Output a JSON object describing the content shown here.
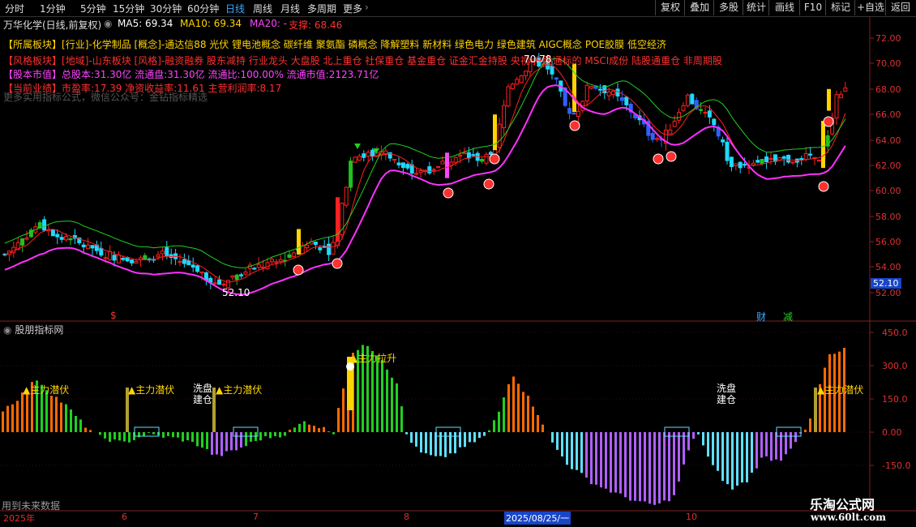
{
  "toolbar": {
    "timeframes": [
      "分时",
      "1分钟",
      "5分钟",
      "15分钟",
      "30分钟",
      "60分钟",
      "日线",
      "周线",
      "月线",
      "多周期",
      "更多"
    ],
    "active_timeframe": "日线",
    "right_buttons": [
      "复权",
      "叠加",
      "多股",
      "统计",
      "画线",
      "F10",
      "标记",
      "+自选",
      "返回"
    ]
  },
  "chart_header": {
    "title": "万华化学(日线,前复权)",
    "ma5": "MA5: 69.34",
    "ma10": "MA10: 69.34",
    "ma20": "MA20: -",
    "support": "支撑: 68.46"
  },
  "info_lines": [
    {
      "label": "【所属板块】",
      "value": "[行业]-化学制品 [概念]-通达信88 光伏 锂电池概念 碳纤维 聚氨酯 磷概念 降解塑料 新材料 绿色电力 绿色建筑 AIGC概念 POE胶膜 低空经济"
    },
    {
      "label": "【风格板块】",
      "value": "[地域]-山东板块 [风格]-融资融券 股东减持 行业龙头 大盘股 北上重仓 社保重仓 基金重仓 证金汇金持股 央视 户股通标的 MSCI成份 陆股通重仓 非周期股"
    },
    {
      "label": "【股本市值】",
      "value": "总股本:31.30亿 流通盘:31.30亿 流通比:100.00% 流通市值:2123.71亿"
    },
    {
      "label": "【当前业绩】",
      "value": "市盈率:17.39 净资收益率:11.61 主营利润率:8.17"
    }
  ],
  "watermark_text": "更多实用指标公式，微信公众号：金钻指标精选",
  "price_axis": [
    "72.00",
    "70.00",
    "68.00",
    "66.00",
    "64.00",
    "62.00",
    "60.00",
    "58.00",
    "56.00",
    "54.00",
    "52.00"
  ],
  "current_price_tag": "52.10",
  "high_label": "70.78",
  "low_label": "52.10",
  "markers": {
    "cai": "财",
    "jian": "减",
    "dollar": "$"
  },
  "indicator": {
    "name": "股朋指标网",
    "axis": [
      "450.0",
      "300.0",
      "150.0",
      "0.00",
      "-150.0"
    ],
    "labels": [
      "主力潜伏",
      "主力潜伏",
      "主力潜伏",
      "主力拉升",
      "主力潜伏"
    ],
    "wash_label": "洗盘\n建仓",
    "footer_note": "用到未来数据"
  },
  "x_axis": [
    "2025年",
    "6",
    "7",
    "8",
    "2025/08/25/一",
    "10"
  ],
  "brand": {
    "name": "乐淘公式网",
    "url": "www.60lt.com"
  },
  "chart_data": {
    "type": "candlestick",
    "title": "万华化学(日线,前复权)",
    "ylim": [
      51,
      73
    ],
    "indicator_ylim": [
      -200,
      450
    ],
    "series": [
      {
        "name": "MA5",
        "values": [
          69.34
        ]
      },
      {
        "name": "MA10",
        "values": [
          69.34
        ]
      }
    ],
    "key_points": {
      "low": 52.1,
      "high": 70.78,
      "support": 68.46
    }
  }
}
